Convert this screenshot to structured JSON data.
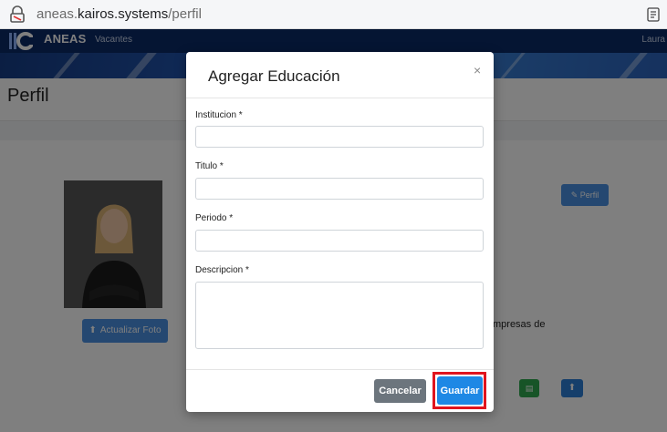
{
  "browser": {
    "url_prefix": "aneas.",
    "url_domain": "kairos.systems",
    "url_path": "/perfil"
  },
  "navbar": {
    "brand": "ANEAS",
    "menu_item": "Vacantes",
    "user": "Laura"
  },
  "page": {
    "title": "Perfil",
    "update_photo_label": "Actualizar Foto",
    "profile_button_label": "Perfil",
    "partial_text": "mpresas de"
  },
  "modal": {
    "title": "Agregar Educación",
    "close_symbol": "×",
    "fields": {
      "institucion": {
        "label": "Institucion *",
        "value": "",
        "placeholder": ""
      },
      "titulo": {
        "label": "Titulo *",
        "value": "",
        "placeholder": ""
      },
      "periodo": {
        "label": "Periodo *",
        "value": "",
        "placeholder": ""
      },
      "descripcion": {
        "label": "Descripcion *",
        "value": "",
        "placeholder": ""
      }
    },
    "buttons": {
      "cancel": "Cancelar",
      "save": "Guardar"
    }
  },
  "colors": {
    "navbar": "#0b2a66",
    "primary": "#1e88e5",
    "secondary": "#6c757d",
    "success": "#2ea84f",
    "highlight": "#e0141e"
  },
  "icons": {
    "url_bar": "lock-icon",
    "reader": "reader-mode-icon",
    "upload": "upload-icon",
    "edit": "pencil-icon",
    "pdf": "document-icon"
  }
}
